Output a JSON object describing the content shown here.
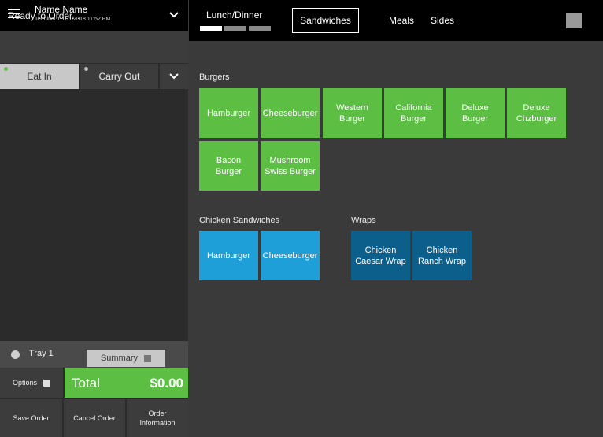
{
  "header": {
    "user_name": "Name Name",
    "terminal_info": "Terminal 1 11/1/2018 11:52 PM"
  },
  "status_text": "Ready to Order...",
  "order_type_tabs": [
    "Eat In",
    "Carry Out"
  ],
  "tray": {
    "label": "Tray 1",
    "summary_label": "Summary"
  },
  "options_label": "Options",
  "total": {
    "label": "Total",
    "value": "$0.00"
  },
  "bottom_buttons": [
    "Save Order",
    "Cancel Order",
    "Order Information"
  ],
  "menu": {
    "page_label": "Lunch/Dinner",
    "categories": [
      "Sandwiches",
      "Meals",
      "Sides"
    ],
    "selected_category": "Sandwiches"
  },
  "sections": {
    "burgers": {
      "title": "Burgers",
      "items": [
        "Hamburger",
        "Cheeseburger",
        "Western Burger",
        "California Burger",
        "Deluxe Burger",
        "Deluxe Chzburger",
        "Bacon Burger",
        "Mushroom Swiss Burger"
      ]
    },
    "chicken": {
      "title": "Chicken Sandwiches",
      "items": [
        "Hamburger",
        "Cheeseburger"
      ]
    },
    "wraps": {
      "title": "Wraps",
      "items": [
        "Chicken Caesar Wrap",
        "Chicken Ranch Wrap"
      ]
    }
  },
  "colors": {
    "burger_tile": "#5cbf44",
    "chicken_tile": "#1e9fd8",
    "wrap_tile": "#0b5f8a",
    "eat_in_indicator": "#5cbf44",
    "total_background": "#5cbf44"
  }
}
